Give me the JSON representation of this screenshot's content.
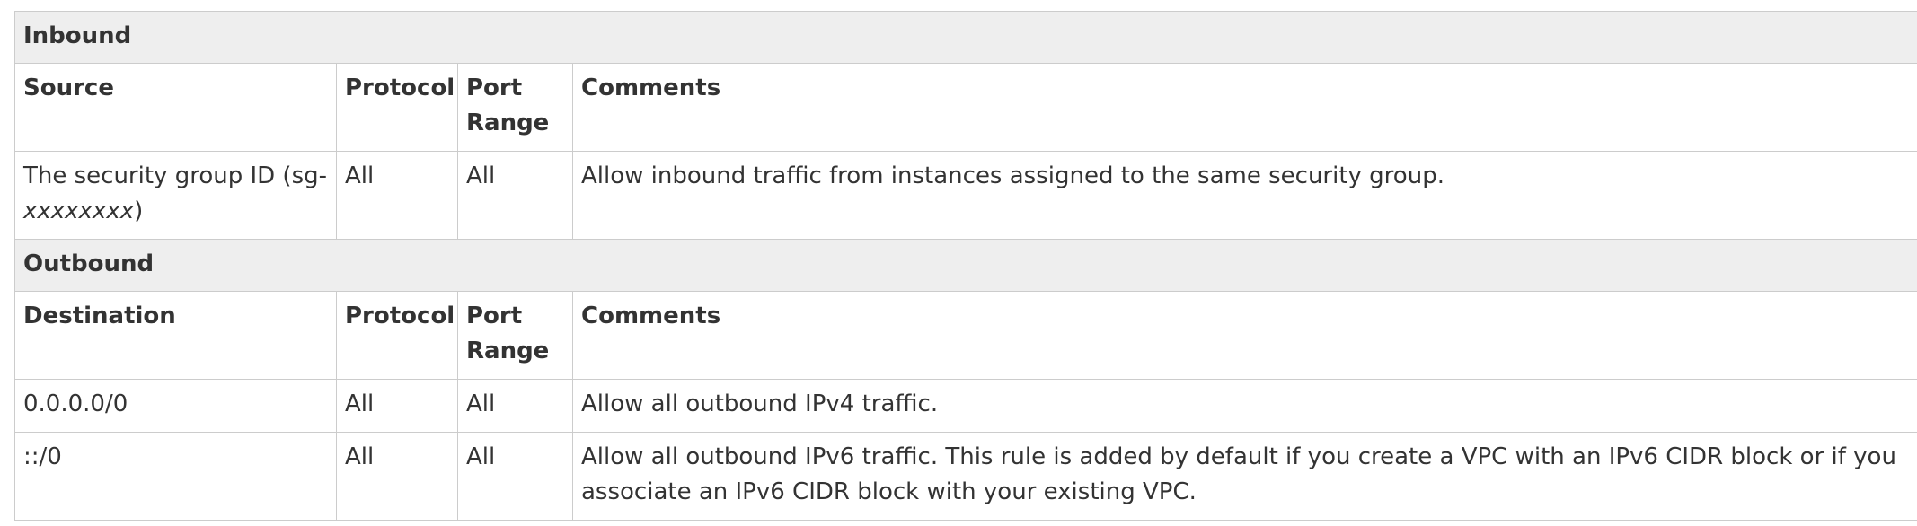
{
  "inbound": {
    "section_title": "Inbound",
    "headers": {
      "source": "Source",
      "protocol": "Protocol",
      "port_range_1": "Port",
      "port_range_2": "Range",
      "comments": "Comments"
    },
    "rows": [
      {
        "source_text": "The security group ID (sg-",
        "source_italic": "xxxxxxxx",
        "source_tail": ")",
        "protocol": "All",
        "port_range": "All",
        "comments": "Allow inbound traffic from instances assigned to the same security group."
      }
    ]
  },
  "outbound": {
    "section_title": "Outbound",
    "headers": {
      "destination": "Destination",
      "protocol": "Protocol",
      "port_range_1": "Port",
      "port_range_2": "Range",
      "comments": "Comments"
    },
    "rows": [
      {
        "destination": "0.0.0.0/0",
        "protocol": "All",
        "port_range": "All",
        "comments": "Allow all outbound IPv4 traffic."
      },
      {
        "destination": "::/0",
        "protocol": "All",
        "port_range": "All",
        "comments": "Allow all outbound IPv6 traffic. This rule is added by default if you create a VPC with an IPv6 CIDR block or if you associate an IPv6 CIDR block with your existing VPC."
      }
    ]
  },
  "colors": {
    "section_background": "#eeeeee",
    "border": "#cccccc",
    "text": "#333333"
  }
}
